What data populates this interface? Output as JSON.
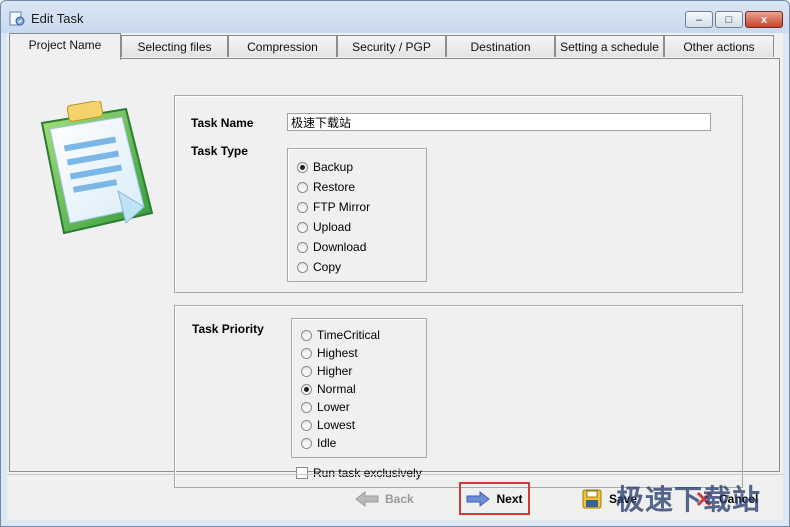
{
  "window": {
    "title": "Edit Task",
    "icon": "task-app-icon"
  },
  "title_buttons": {
    "minimize": "–",
    "maximize": "□",
    "close": "x"
  },
  "tabs": [
    {
      "label": "Project Name",
      "active": true
    },
    {
      "label": "Selecting files"
    },
    {
      "label": "Compression"
    },
    {
      "label": "Security / PGP"
    },
    {
      "label": "Destination"
    },
    {
      "label": "Setting a schedule"
    },
    {
      "label": "Other actions"
    }
  ],
  "task_name": {
    "label": "Task Name",
    "value": "极速下载站"
  },
  "task_type": {
    "label": "Task Type",
    "options": [
      "Backup",
      "Restore",
      "FTP Mirror",
      "Upload",
      "Download",
      "Copy"
    ],
    "selected": "Backup"
  },
  "task_priority": {
    "label": "Task Priority",
    "options": [
      "TimeCritical",
      "Highest",
      "Higher",
      "Normal",
      "Lower",
      "Lowest",
      "Idle"
    ],
    "selected": "Normal"
  },
  "run_exclusively": {
    "label": "Run task exclusively",
    "checked": false
  },
  "footer": {
    "back": "Back",
    "next": "Next",
    "save": "Save",
    "cancel": "Cancel"
  },
  "watermark": "极速下载站",
  "colors": {
    "accent_border": "#d23a3a",
    "group_border": "#a7a7a7",
    "arrow_blue": "#3f5fb0"
  }
}
